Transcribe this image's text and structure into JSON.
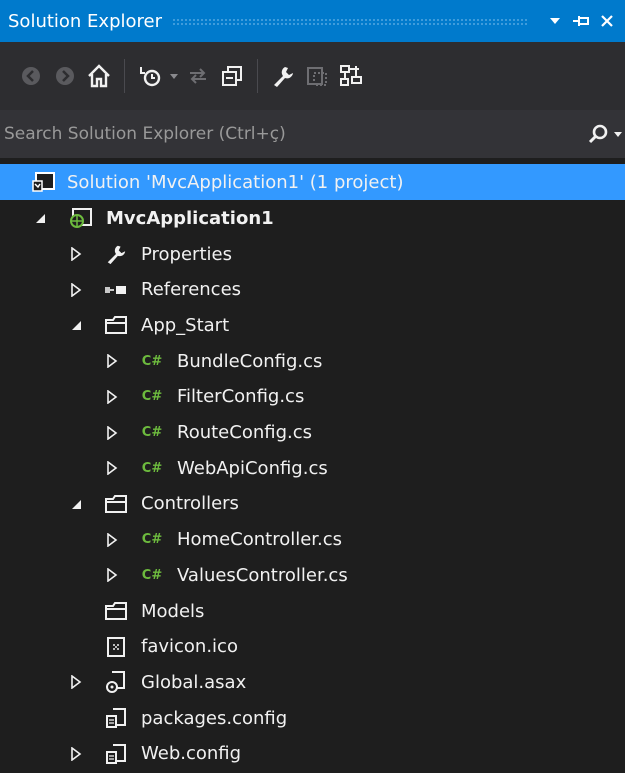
{
  "window": {
    "title": "Solution Explorer",
    "accent_color": "#007acc",
    "title_buttons": [
      "dropdown-icon",
      "pin-icon",
      "close-icon"
    ]
  },
  "toolbar": {
    "buttons": [
      "back-icon",
      "forward-icon",
      "home-icon",
      "pending-changes-filter-icon",
      "sync-icon",
      "collapse-all-icon",
      "properties-icon",
      "show-all-files-icon",
      "view-class-diagram-icon"
    ]
  },
  "search": {
    "placeholder": "Search Solution Explorer (Ctrl+ç)"
  },
  "tree": {
    "selection_color": "#3399ff",
    "solution": {
      "label": "Solution 'MvcApplication1' (1 project)",
      "icon": "solution-icon"
    },
    "project": {
      "label": "MvcApplication1",
      "icon": "web-project-icon",
      "expanded": true
    },
    "items": [
      {
        "label": "Properties",
        "icon": "wrench-icon",
        "expander": "collapsed",
        "level": 1
      },
      {
        "label": "References",
        "icon": "references-icon",
        "expander": "collapsed",
        "level": 1
      },
      {
        "label": "App_Start",
        "icon": "folder-icon",
        "expander": "expanded",
        "level": 1
      },
      {
        "label": "BundleConfig.cs",
        "icon": "csharp-icon",
        "expander": "collapsed",
        "level": 2
      },
      {
        "label": "FilterConfig.cs",
        "icon": "csharp-icon",
        "expander": "collapsed",
        "level": 2
      },
      {
        "label": "RouteConfig.cs",
        "icon": "csharp-icon",
        "expander": "collapsed",
        "level": 2
      },
      {
        "label": "WebApiConfig.cs",
        "icon": "csharp-icon",
        "expander": "collapsed",
        "level": 2
      },
      {
        "label": "Controllers",
        "icon": "folder-icon",
        "expander": "expanded",
        "level": 1
      },
      {
        "label": "HomeController.cs",
        "icon": "csharp-icon",
        "expander": "collapsed",
        "level": 2
      },
      {
        "label": "ValuesController.cs",
        "icon": "csharp-icon",
        "expander": "collapsed",
        "level": 2
      },
      {
        "label": "Models",
        "icon": "folder-icon",
        "expander": "none",
        "level": 1
      },
      {
        "label": "favicon.ico",
        "icon": "image-file-icon",
        "expander": "none",
        "level": 1
      },
      {
        "label": "Global.asax",
        "icon": "global-asax-icon",
        "expander": "collapsed",
        "level": 1
      },
      {
        "label": "packages.config",
        "icon": "config-file-icon",
        "expander": "none",
        "level": 1
      },
      {
        "label": "Web.config",
        "icon": "config-file-icon",
        "expander": "collapsed",
        "level": 1
      }
    ]
  }
}
